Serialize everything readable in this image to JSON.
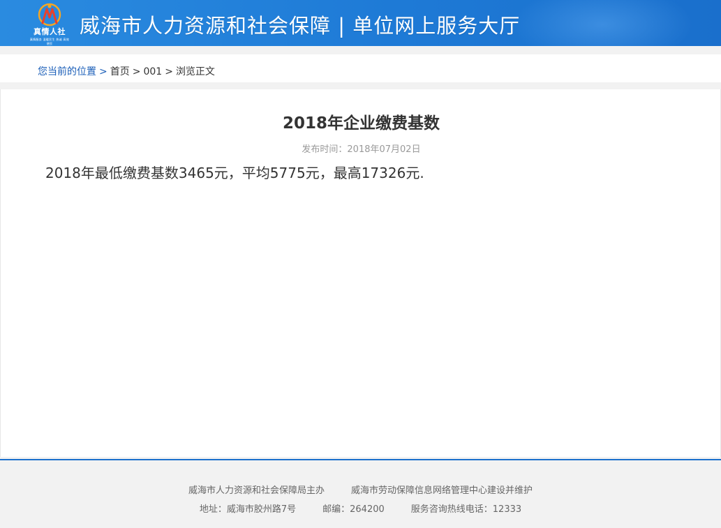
{
  "header": {
    "logo_text": "真情人社",
    "logo_subtext": "真情服务 温暖民生 热诚 高效 便民",
    "site_title": "威海市人力资源和社会保障 | 单位网上服务大厅",
    "brand_color": "#1e7ad6"
  },
  "breadcrumb": {
    "label": "您当前的位置",
    "separator": ">",
    "items": [
      "首页",
      "001",
      "浏览正文"
    ]
  },
  "article": {
    "title": "2018年企业缴费基数",
    "publish_time": "发布时间：2018年07月02日",
    "body": "2018年最低缴费基数3465元，平均5775元，最高17326元."
  },
  "footer": {
    "sponsor": "威海市人力资源和社会保障局主办",
    "maintainer": "威海市劳动保障信息网络管理中心建设并维护",
    "address": "地址：威海市胶州路7号",
    "postcode": "邮编：264200",
    "hotline": "服务咨询热线电话：12333"
  }
}
